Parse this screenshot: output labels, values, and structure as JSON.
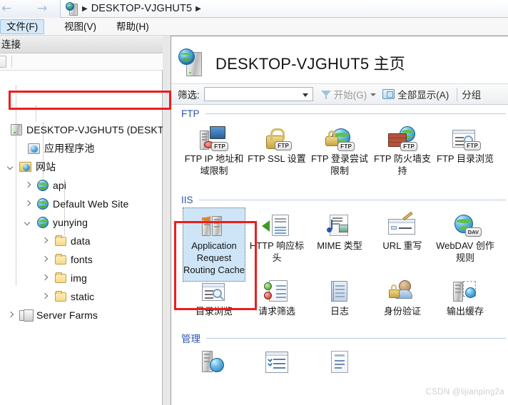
{
  "window": {
    "breadcrumb_host": "DESKTOP-VJGHUT5",
    "back_arrow": "←",
    "forward_arrow": "→",
    "crumb_separator": "▶"
  },
  "menu": {
    "items": [
      {
        "text": "文件(F)",
        "key": "F",
        "active": true
      },
      {
        "text": "视图(V)",
        "key": "V",
        "active": false
      },
      {
        "text": "帮助(H)",
        "key": "H",
        "active": false
      }
    ]
  },
  "connections": {
    "header": "连接",
    "tree": [
      {
        "label": "DESKTOP-VJGHUT5 (DESKT",
        "icon": "server-icon",
        "depth": 0,
        "expander": "none",
        "selected": true
      },
      {
        "label": "应用程序池",
        "icon": "application-pools-icon",
        "depth": 1,
        "expander": "none"
      },
      {
        "label": "网站",
        "icon": "sites-folder-icon",
        "depth": 1,
        "expander": "expanded"
      },
      {
        "label": "api",
        "icon": "website-icon",
        "depth": 2,
        "expander": "collapsed"
      },
      {
        "label": "Default Web Site",
        "icon": "website-icon",
        "depth": 2,
        "expander": "collapsed"
      },
      {
        "label": "yunying",
        "icon": "website-icon",
        "depth": 2,
        "expander": "expanded"
      },
      {
        "label": "data",
        "icon": "folder-icon",
        "depth": 3,
        "expander": "collapsed"
      },
      {
        "label": "fonts",
        "icon": "folder-icon",
        "depth": 3,
        "expander": "collapsed"
      },
      {
        "label": "img",
        "icon": "folder-icon",
        "depth": 3,
        "expander": "collapsed"
      },
      {
        "label": "static",
        "icon": "folder-icon",
        "depth": 3,
        "expander": "collapsed"
      },
      {
        "label": "Server Farms",
        "icon": "server-farm-icon",
        "depth": 1,
        "expander": "collapsed"
      }
    ]
  },
  "content": {
    "title": "DESKTOP-VJGHUT5 主页",
    "title_icon": "server-globe-icon"
  },
  "filterbar": {
    "label": "筛选:",
    "combo_value": "",
    "combo_placeholder": "",
    "go_button": "开始(G)",
    "go_key": "G",
    "show_all_button": "全部显示(A)",
    "show_all_key": "A",
    "group_button": "分组"
  },
  "sections": [
    {
      "name": "FTP",
      "tiles": [
        {
          "label": "FTP IP 地址和域限制",
          "icon": "ftp-ip-address-restrictions-icon",
          "badge": "FTP"
        },
        {
          "label": "FTP SSL 设置",
          "icon": "ftp-ssl-settings-icon",
          "badge": "FTP"
        },
        {
          "label": "FTP 登录尝试限制",
          "icon": "ftp-logon-attempt-restrictions-icon",
          "badge": "FTP"
        },
        {
          "label": "FTP 防火墙支持",
          "icon": "ftp-firewall-support-icon",
          "badge": "FTP"
        },
        {
          "label": "FTP 目录浏览",
          "icon": "ftp-directory-browsing-icon",
          "badge": "FTP"
        }
      ]
    },
    {
      "name": "IIS",
      "tiles_row1": [
        {
          "label": "Application Request Routing Cache",
          "icon": "application-request-routing-cache-icon",
          "selected": true
        },
        {
          "label": "HTTP 响应标头",
          "icon": "http-response-headers-icon"
        },
        {
          "label": "MIME 类型",
          "icon": "mime-types-icon"
        },
        {
          "label": "URL 重写",
          "icon": "url-rewrite-icon"
        },
        {
          "label": "WebDAV 创作规则",
          "icon": "webdav-authoring-rules-icon",
          "badge": "DAV"
        }
      ],
      "tiles_row2": [
        {
          "label": "目录浏览",
          "icon": "directory-browsing-icon"
        },
        {
          "label": "请求筛选",
          "icon": "request-filtering-icon"
        },
        {
          "label": "日志",
          "icon": "logging-icon"
        },
        {
          "label": "身份验证",
          "icon": "authentication-icon"
        },
        {
          "label": "输出缓存",
          "icon": "output-caching-icon"
        }
      ]
    },
    {
      "name": "管理",
      "tiles": [
        {
          "label": "",
          "icon": "shared-configuration-icon"
        },
        {
          "label": "",
          "icon": "feature-delegation-icon"
        },
        {
          "label": "",
          "icon": "configuration-editor-icon"
        }
      ]
    }
  ],
  "annotations": {
    "highlight_color": "#ee1c1c",
    "boxes": [
      {
        "name": "tree-root-highlight"
      },
      {
        "name": "arr-cache-tile-highlight"
      }
    ]
  },
  "watermark": "CSDN @lijianping2a"
}
